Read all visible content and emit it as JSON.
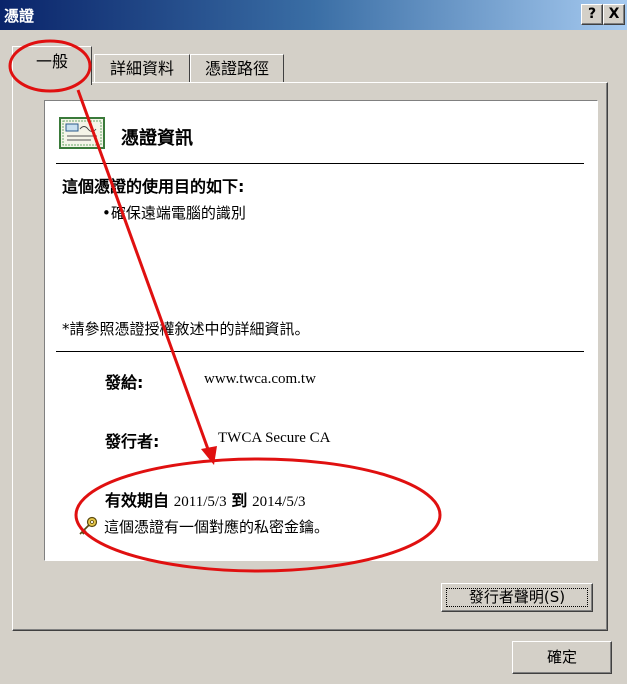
{
  "window": {
    "title": "憑證",
    "help_label": "?",
    "close_label": "X"
  },
  "tabs": [
    {
      "label": "一般",
      "active": true
    },
    {
      "label": "詳細資料",
      "active": false
    },
    {
      "label": "憑證路徑",
      "active": false
    }
  ],
  "info": {
    "title": "憑證資訊",
    "purpose_heading": "這個憑證的使用目的如下:",
    "purpose_items": [
      "•確保遠端電腦的識別"
    ],
    "note": "*請參照憑證授權敘述中的詳細資訊。",
    "issued_to_label": "發給:",
    "issued_to_value": "www.twca.com.tw",
    "issued_by_label": "發行者:",
    "issued_by_value": "TWCA Secure CA",
    "valid_from_label": "有效期自",
    "valid_from": "2011/5/3",
    "valid_to_label": "到",
    "valid_to": "2014/5/3",
    "private_key_note": "這個憑證有一個對應的私密金鑰。"
  },
  "buttons": {
    "issuer_statement": "發行者聲明(S)",
    "ok": "確定"
  },
  "icons": {
    "certificate": "certificate-icon",
    "key": "key-icon"
  },
  "colors": {
    "annotation": "#e01010",
    "dialog_bg": "#d4d0c8"
  }
}
